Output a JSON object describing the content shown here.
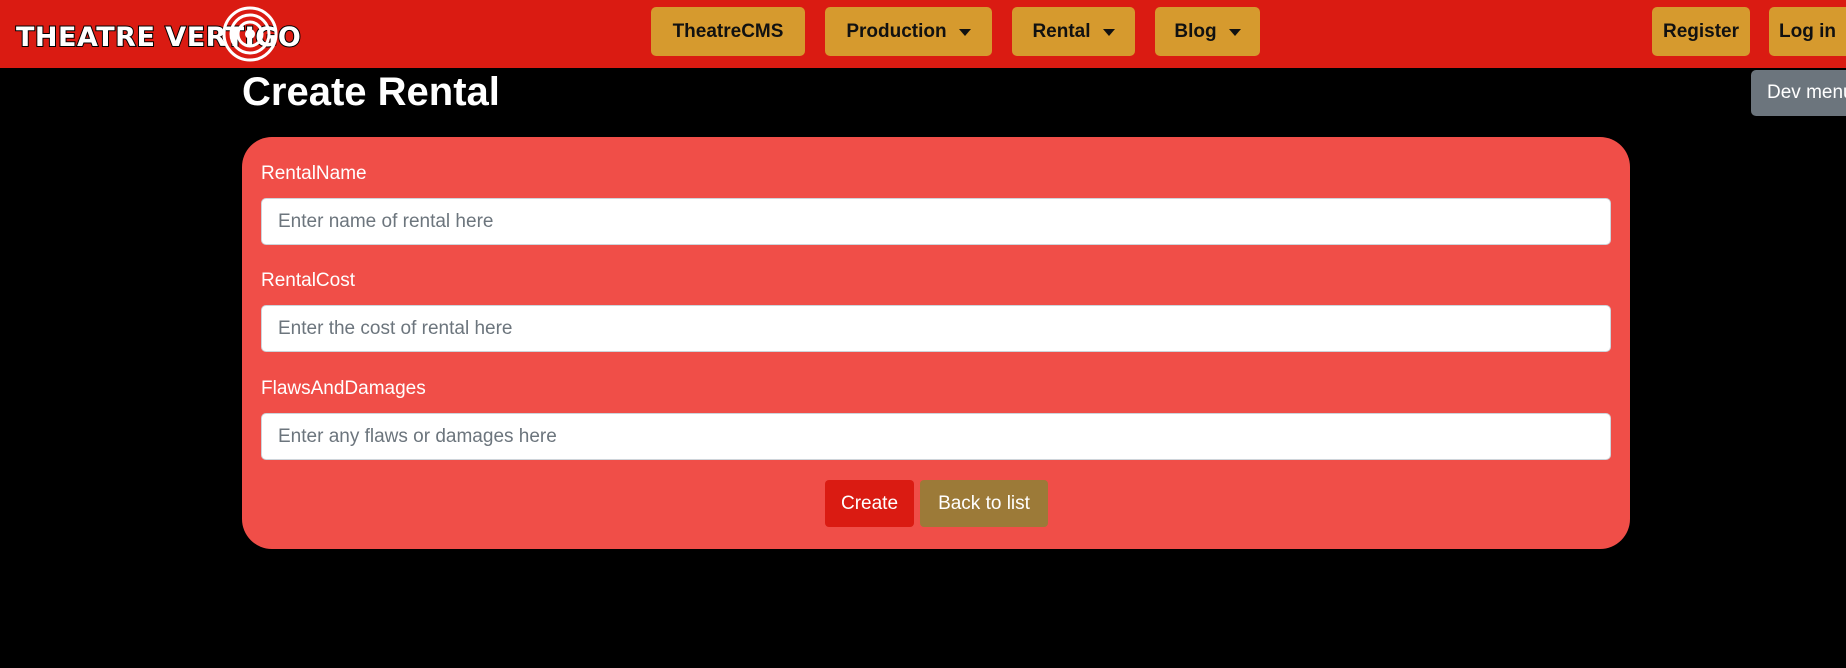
{
  "brand": {
    "logo_text": "THEATRE VERTIGO"
  },
  "nav": {
    "home": "TheatreCMS",
    "production": "Production",
    "rental": "Rental",
    "blog": "Blog",
    "register": "Register",
    "login": "Log in"
  },
  "dev_menu": "Dev menu",
  "page": {
    "title": "Create Rental"
  },
  "form": {
    "rental_name": {
      "label": "RentalName",
      "placeholder": "Enter name of rental here"
    },
    "rental_cost": {
      "label": "RentalCost",
      "placeholder": "Enter the cost of rental here"
    },
    "flaws": {
      "label": "FlawsAndDamages",
      "placeholder": "Enter any flaws or damages here"
    },
    "create_label": "Create",
    "back_label": "Back to list"
  },
  "colors": {
    "navbar": "#da1b12",
    "nav_button": "#d69a2e",
    "card": "#f04e48",
    "create_button": "#da1b12",
    "back_button": "#9c7a38",
    "dev_menu": "#6c757d"
  }
}
